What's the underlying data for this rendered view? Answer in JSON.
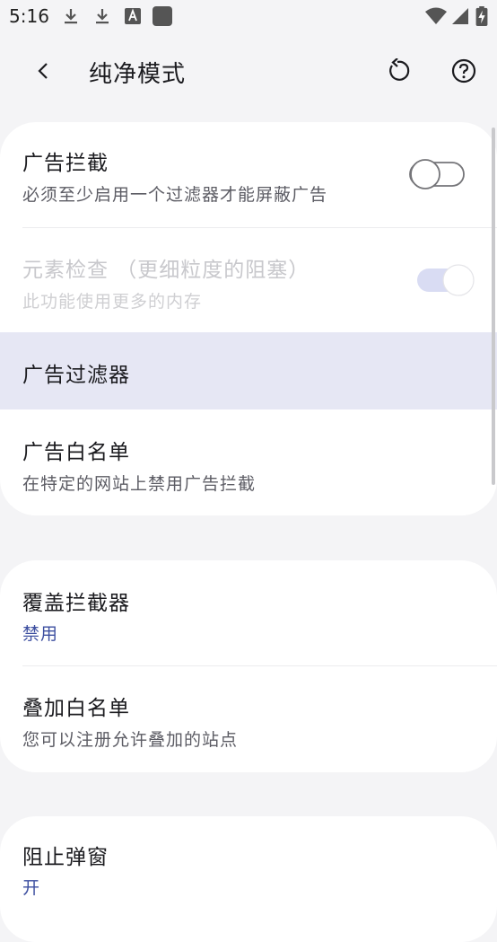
{
  "status_bar": {
    "time": "5:16",
    "left_icons": [
      "download-icon",
      "download-icon",
      "text-a-icon",
      "app-square-icon"
    ],
    "right_icons": [
      "wifi-icon",
      "signal-icon",
      "battery-charging-icon"
    ]
  },
  "app_bar": {
    "title": "纯净模式",
    "actions": [
      "back-icon",
      "reset-icon",
      "help-icon"
    ]
  },
  "card1": {
    "ad_block": {
      "title": "广告拦截",
      "subtitle": "必须至少启用一个过滤器才能屏蔽广告",
      "toggle": "off"
    },
    "element_inspect": {
      "title": "元素检查 （更细粒度的阻塞）",
      "subtitle": "此功能使用更多的内存",
      "toggle": "on-disabled"
    },
    "ad_filters": {
      "title": "广告过滤器"
    },
    "ad_whitelist": {
      "title": "广告白名单",
      "subtitle": "在特定的网站上禁用广告拦截"
    }
  },
  "card2": {
    "overlay_blocker": {
      "title": "覆盖拦截器",
      "value": "禁用"
    },
    "overlay_whitelist": {
      "title": "叠加白名单",
      "subtitle": "您可以注册允许叠加的站点"
    }
  },
  "card3": {
    "block_popups": {
      "title": "阻止弹窗",
      "value": "开"
    }
  },
  "colors": {
    "background": "#f4f4f6",
    "card": "#ffffff",
    "accent": "#3d4fa0",
    "highlight": "#e6e7f4",
    "switch_on": "#c9cef0"
  }
}
